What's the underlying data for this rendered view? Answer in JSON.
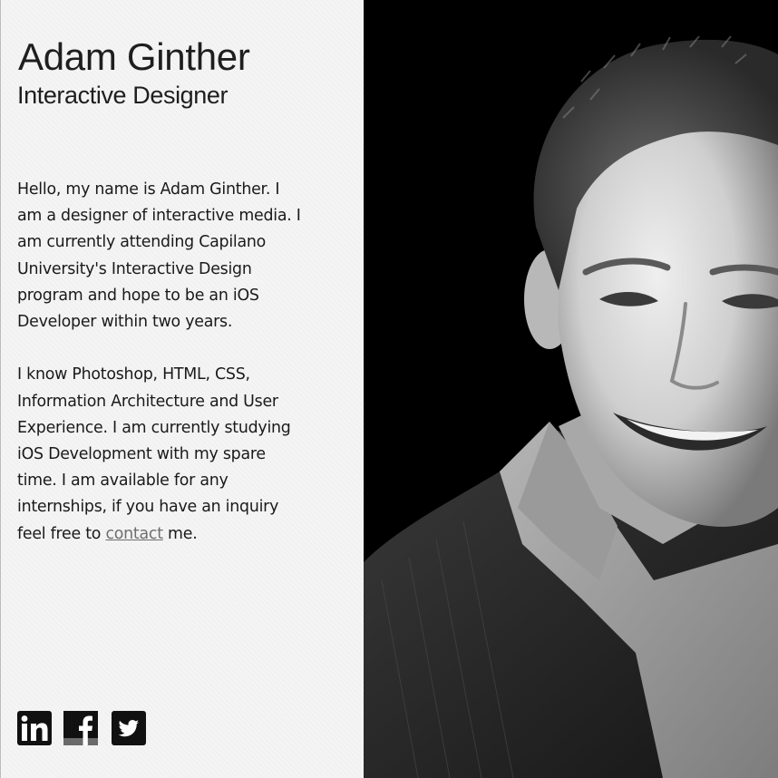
{
  "profile": {
    "name": "Adam Ginther",
    "title": "Interactive Designer"
  },
  "bio": {
    "paragraph1_lines": [
      "Hello, my name is Adam Ginther. I",
      "am a designer of interactive media. I",
      "am currently attending Capilano",
      "University's Interactive Design",
      "program and hope to be an iOS",
      "Developer within two years."
    ],
    "paragraph2_lines": [
      "I know Photoshop, HTML, CSS,",
      "Information Architecture and User",
      "Experience. I am currently studying",
      "iOS Development with my spare",
      "time. I am available for any",
      "internships, if you have an inquiry"
    ],
    "last_line_before": "feel free to ",
    "contact_link_text": "contact",
    "last_line_after": " me."
  },
  "social": {
    "linkedin_glyph": "in",
    "facebook_glyph": "f",
    "icons": [
      "linkedin-icon",
      "facebook-icon",
      "twitter-icon"
    ]
  },
  "colors": {
    "panel_background": "#f4f4f4",
    "text": "#1a1a1a",
    "link": "#6e6e6e",
    "photo_background": "#000000"
  }
}
